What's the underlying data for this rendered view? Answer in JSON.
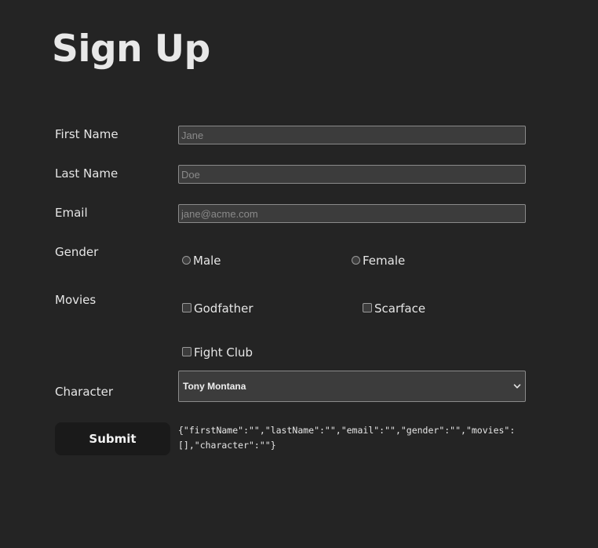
{
  "title": "Sign Up",
  "form": {
    "first_name": {
      "label": "First Name",
      "placeholder": "Jane",
      "value": ""
    },
    "last_name": {
      "label": "Last Name",
      "placeholder": "Doe",
      "value": ""
    },
    "email": {
      "label": "Email",
      "placeholder": "jane@acme.com",
      "value": ""
    },
    "gender": {
      "label": "Gender",
      "options": [
        {
          "label": "Male",
          "checked": false
        },
        {
          "label": "Female",
          "checked": false
        }
      ]
    },
    "movies": {
      "label": "Movies",
      "options": [
        {
          "label": "Godfather",
          "checked": false
        },
        {
          "label": "Scarface",
          "checked": false
        },
        {
          "label": "Fight Club",
          "checked": false
        }
      ]
    },
    "character": {
      "label": "Character",
      "selected": "Tony Montana"
    },
    "submit_label": "Submit"
  },
  "output_json": "{\"firstName\":\"\",\"lastName\":\"\",\"email\":\"\",\"gender\":\"\",\"movies\":[],\"character\":\"\"}",
  "colors": {
    "background": "#242424",
    "input_background": "#3c3c3c",
    "button_background": "#1a1a1a",
    "text": "#e6e6e6"
  }
}
